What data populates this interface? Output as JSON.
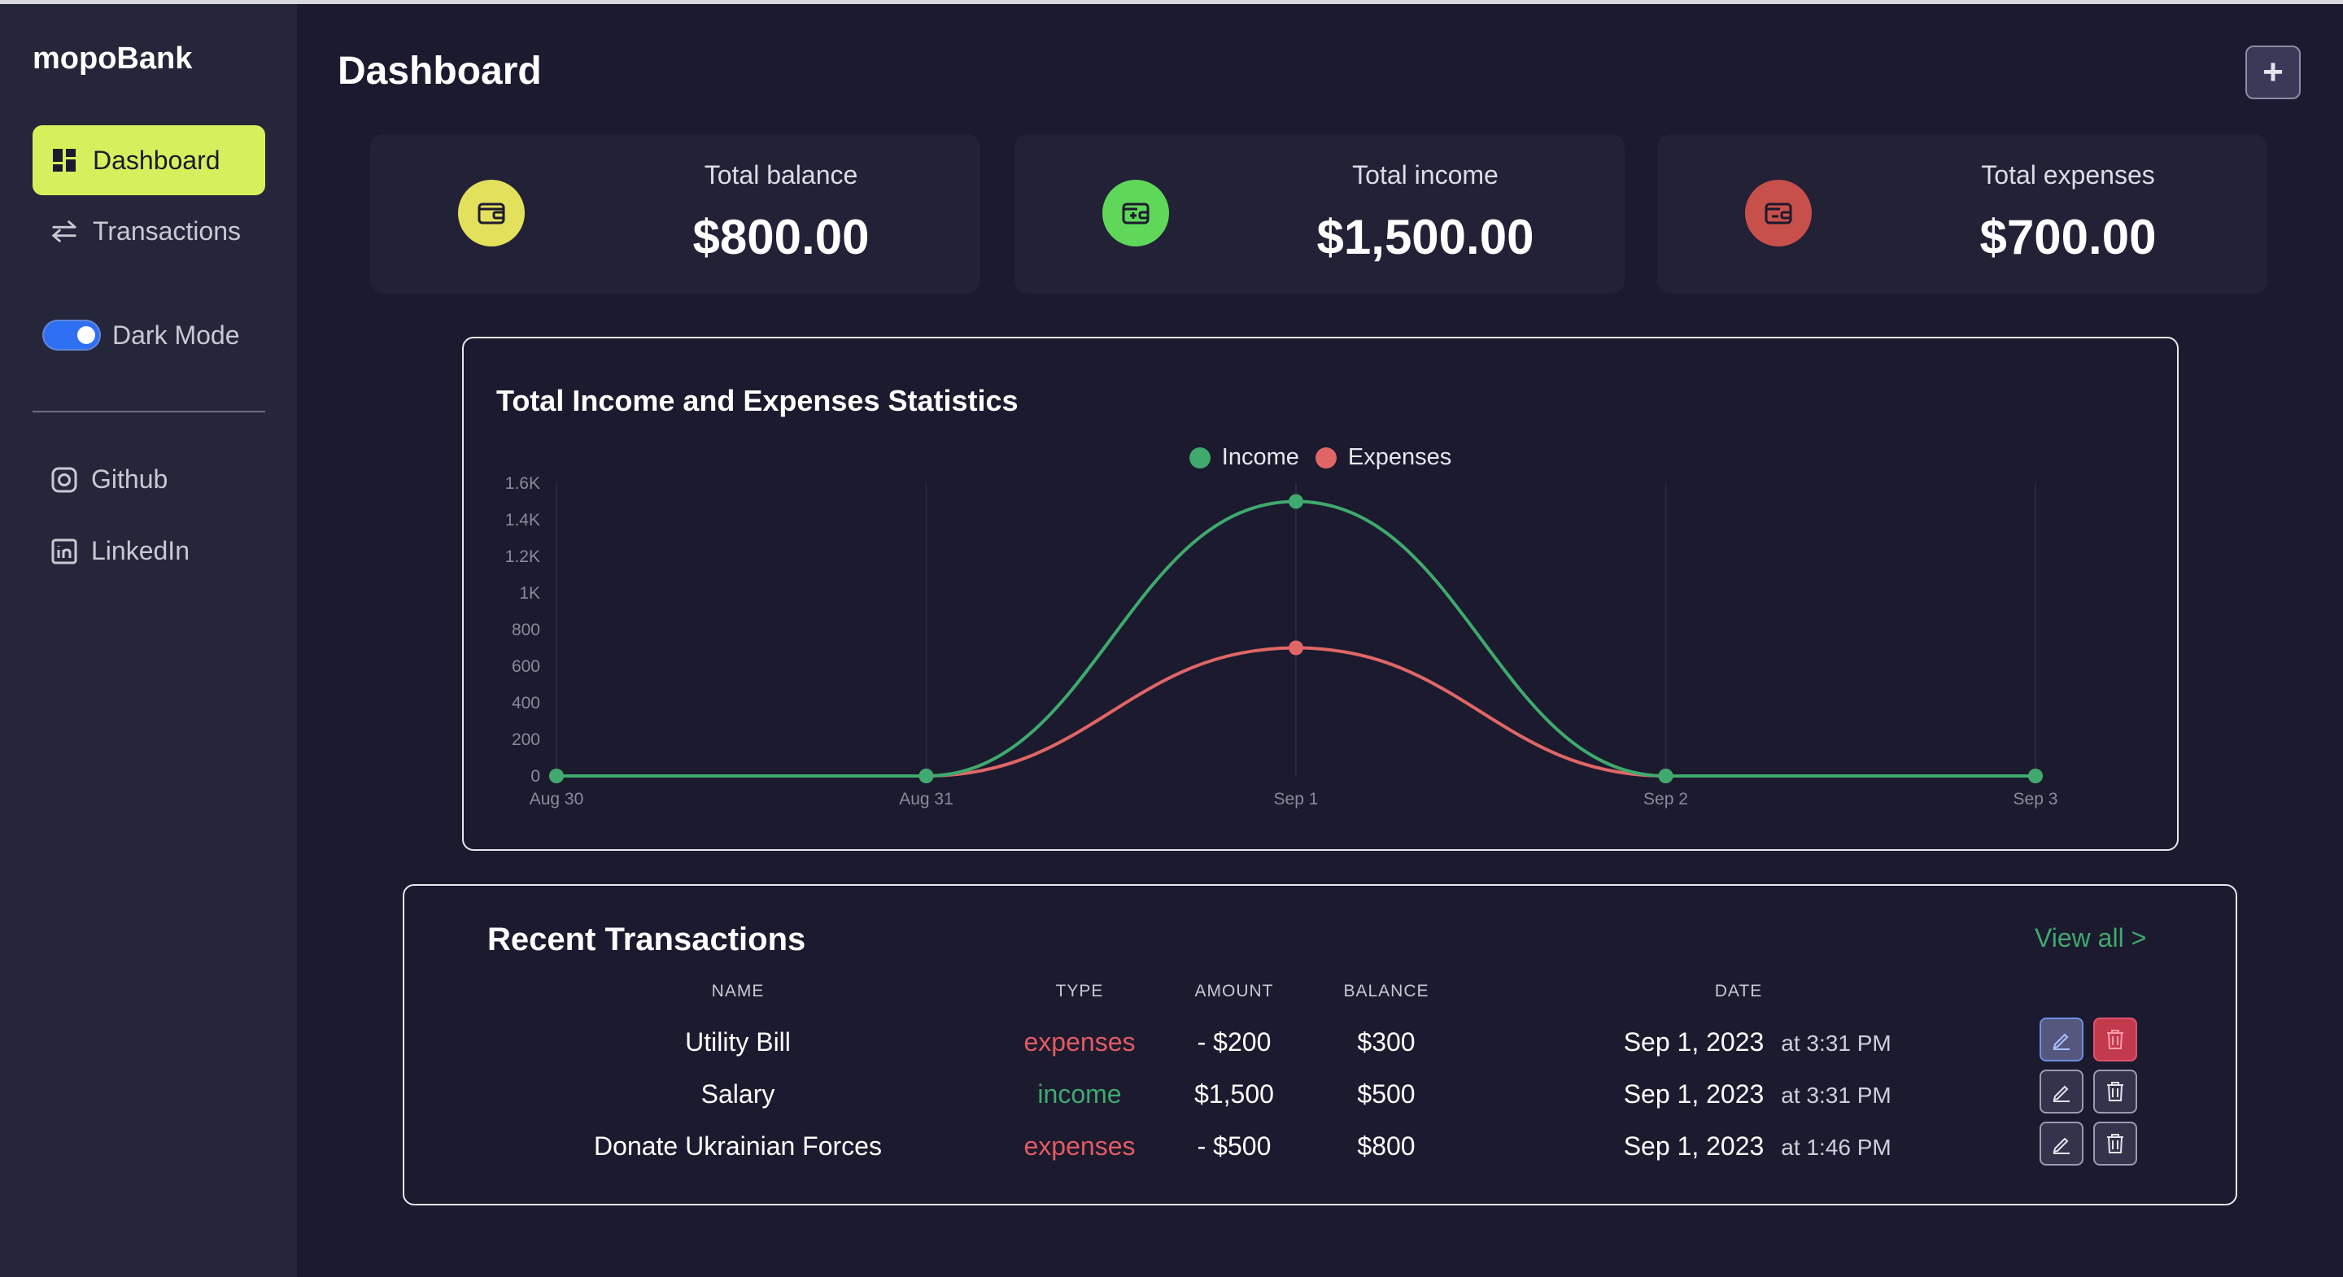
{
  "app": {
    "name": "mopoBank"
  },
  "sidebar": {
    "nav": [
      {
        "label": "Dashboard",
        "icon": "dashboard-grid-icon",
        "active": true
      },
      {
        "label": "Transactions",
        "icon": "arrows-swap-icon",
        "active": false
      }
    ],
    "dark_mode": {
      "label": "Dark Mode",
      "enabled": true
    },
    "social": [
      {
        "label": "Github",
        "icon": "github-icon"
      },
      {
        "label": "LinkedIn",
        "icon": "linkedin-icon"
      }
    ]
  },
  "header": {
    "title": "Dashboard",
    "add_label": "+"
  },
  "stats": [
    {
      "label": "Total balance",
      "value": "$800.00",
      "color": "#e3e05c",
      "icon": "wallet-icon"
    },
    {
      "label": "Total income",
      "value": "$1,500.00",
      "color": "#5fd85a",
      "icon": "wallet-plus-icon"
    },
    {
      "label": "Total expenses",
      "value": "$700.00",
      "color": "#c8504a",
      "icon": "wallet-minus-icon"
    }
  ],
  "chart": {
    "title": "Total Income and Expenses Statistics",
    "legend": [
      {
        "name": "Income",
        "color": "#3fa96e"
      },
      {
        "name": "Expenses",
        "color": "#e06666"
      }
    ]
  },
  "chart_data": {
    "type": "line",
    "title": "Total Income and Expenses Statistics",
    "categories": [
      "Aug 30",
      "Aug 31",
      "Sep 1",
      "Sep 2",
      "Sep 3"
    ],
    "series": [
      {
        "name": "Income",
        "values": [
          0,
          0,
          1500,
          0,
          0
        ],
        "color": "#3fa96e"
      },
      {
        "name": "Expenses",
        "values": [
          0,
          0,
          700,
          0,
          0
        ],
        "color": "#e06666"
      }
    ],
    "ylim": [
      0,
      1600
    ],
    "yticks": [
      "0",
      "200",
      "400",
      "600",
      "800",
      "1K",
      "1.2K",
      "1.4K",
      "1.6K"
    ],
    "legend_position": "top-center",
    "grid": "vertical"
  },
  "transactions": {
    "title": "Recent Transactions",
    "view_all": "View all  >",
    "columns": [
      "NAME",
      "TYPE",
      "AMOUNT",
      "BALANCE",
      "DATE"
    ],
    "rows": [
      {
        "name": "Utility Bill",
        "type": "expenses",
        "amount": "- $200",
        "balance": "$300",
        "date": "Sep 1, 2023",
        "time": "at 3:31 PM"
      },
      {
        "name": "Salary",
        "type": "income",
        "amount": "$1,500",
        "balance": "$500",
        "date": "Sep 1, 2023",
        "time": "at 3:31 PM"
      },
      {
        "name": "Donate Ukrainian Forces",
        "type": "expenses",
        "amount": "- $500",
        "balance": "$800",
        "date": "Sep 1, 2023",
        "time": "at 1:46 PM"
      }
    ],
    "type_colors": {
      "expenses": "#e25b63",
      "income": "#3fa96e"
    }
  }
}
